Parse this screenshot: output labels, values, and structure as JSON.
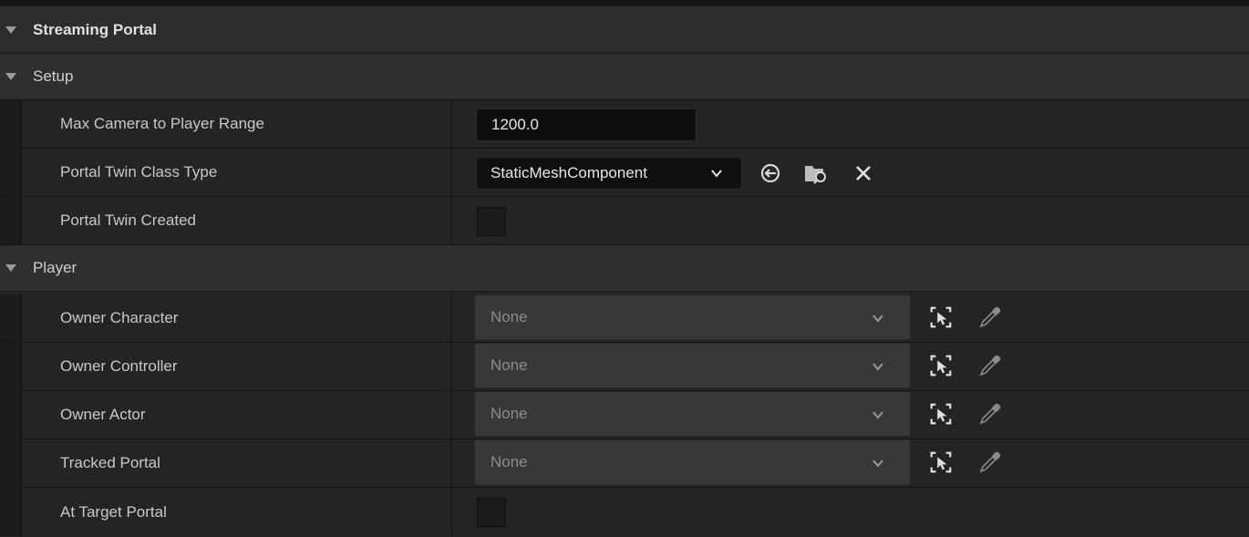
{
  "categories": {
    "streaming_portal": "Streaming Portal",
    "setup": "Setup",
    "player": "Player"
  },
  "setup": {
    "max_camera_range": {
      "label": "Max Camera to Player Range",
      "value": "1200.0"
    },
    "portal_twin_class_type": {
      "label": "Portal Twin Class Type",
      "value": "StaticMeshComponent"
    },
    "portal_twin_created": {
      "label": "Portal Twin Created",
      "checked": false
    }
  },
  "player": {
    "owner_character": {
      "label": "Owner Character",
      "value": "None"
    },
    "owner_controller": {
      "label": "Owner Controller",
      "value": "None"
    },
    "owner_actor": {
      "label": "Owner Actor",
      "value": "None"
    },
    "tracked_portal": {
      "label": "Tracked Portal",
      "value": "None"
    },
    "at_target_portal": {
      "label": "At Target Portal",
      "checked": false
    }
  },
  "icons": {
    "use_selected": "use-selected-arrow-icon",
    "browse": "browse-folder-icon",
    "clear": "clear-x-icon",
    "pick_actor": "pick-actor-icon",
    "eyedropper": "eyedropper-icon"
  },
  "colors": {
    "panel_bg": "#242424",
    "category_bg": "#2f2f2f",
    "input_bg": "#0e0e0e",
    "object_picker_bg": "#383838"
  }
}
